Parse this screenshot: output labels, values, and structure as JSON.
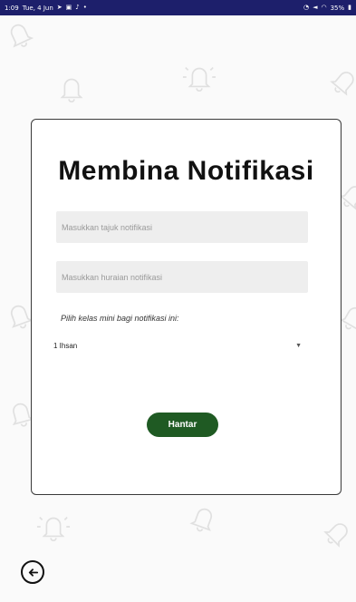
{
  "status_bar": {
    "time": "1:09",
    "date": "Tue, 4 Jun",
    "battery": "35%"
  },
  "card": {
    "title": "Membina Notifikasi",
    "title_placeholder": "Masukkan tajuk notifikasi",
    "description_placeholder": "Masukkan huraian notifikasi",
    "class_prompt": "Pilih kelas mini bagi notifikasi ini:",
    "class_selected": "1 Ihsan",
    "submit_label": "Hantar"
  },
  "colors": {
    "status_bar": "#1d1f6b",
    "submit_button": "#1f5a23",
    "field_background": "#eeeeee"
  },
  "icons": {
    "background": "bell-icon",
    "back": "arrow-left-circle-icon"
  }
}
